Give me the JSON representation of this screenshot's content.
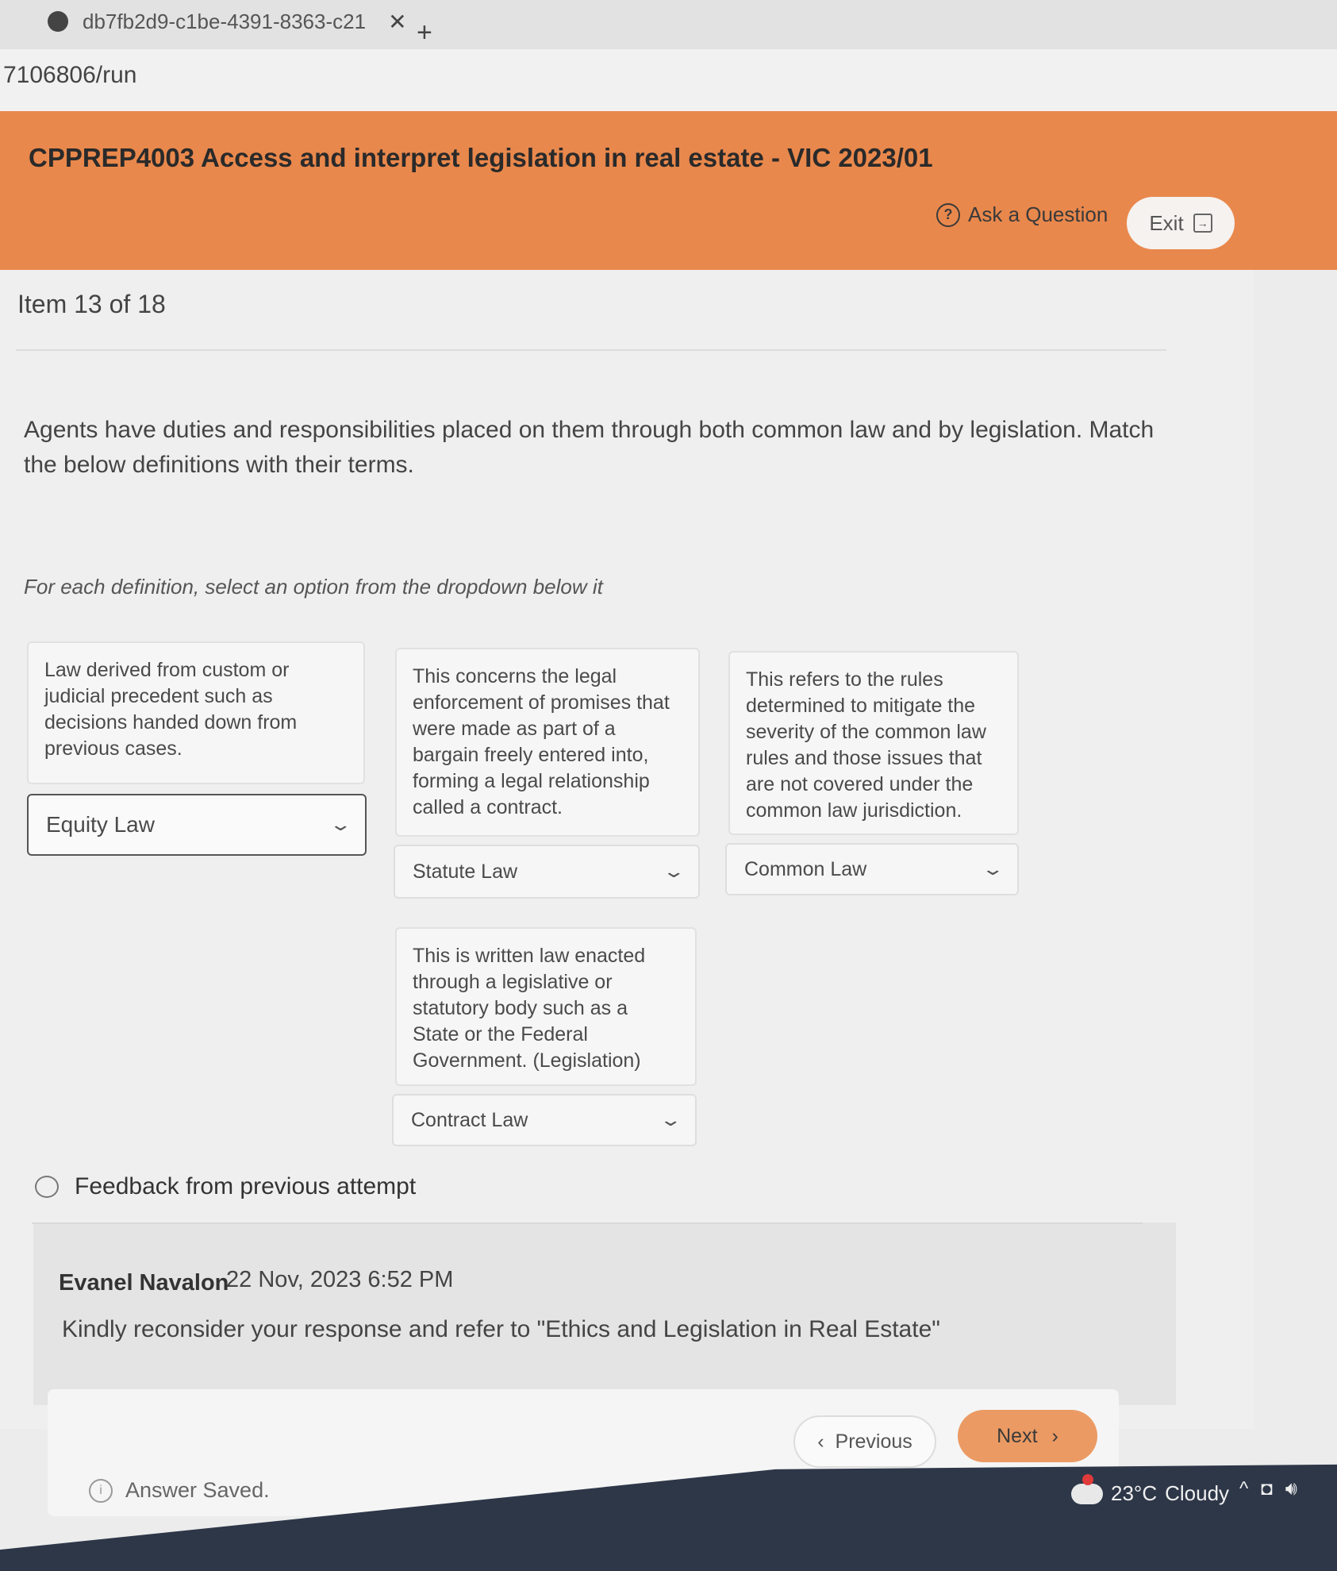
{
  "browser": {
    "tab_title": "db7fb2d9-c1be-4391-8363-c21",
    "tab_close": "✕",
    "new_tab": "+",
    "url": "7106806/run"
  },
  "header": {
    "course_title": "CPPREP4003 Access and interpret legislation in real estate - VIC 2023/01",
    "ask_question": "Ask a Question",
    "exit": "Exit"
  },
  "item": {
    "counter": "Item 13 of 18",
    "question": "Agents have duties and responsibilities placed on them through both common law and by legislation. Match the below definitions with their terms.",
    "instruction": "For each definition, select an option from the dropdown below it"
  },
  "matches": [
    {
      "definition": "Law derived from custom or judicial precedent such as decisions handed down from previous cases.",
      "selected": "Equity Law"
    },
    {
      "definition": "This concerns the legal enforcement of promises that were made as part of a bargain freely entered into, forming a legal relationship called a contract.",
      "selected": "Statute Law"
    },
    {
      "definition": "This refers to the rules determined to mitigate the severity of the common law rules and those issues that are not covered under the common law jurisdiction.",
      "selected": "Common Law"
    },
    {
      "definition": "This is written law enacted through a legislative or statutory body such as a State or the Federal Government. (Legislation)",
      "selected": "Contract Law"
    }
  ],
  "feedback": {
    "title": "Feedback from previous attempt",
    "author": "Evanel Navalon",
    "date": "22 Nov, 2023 6:52 PM",
    "text": "Kindly reconsider your response and refer to \"Ethics and Legislation in Real Estate\""
  },
  "navigation": {
    "previous": "Previous",
    "next": "Next",
    "status": "Answer Saved."
  },
  "taskbar": {
    "temperature": "23°C",
    "condition": "Cloudy"
  },
  "colors": {
    "header": "#e9884c",
    "next_button": "#eb9a63",
    "taskbar": "#2d3748"
  }
}
